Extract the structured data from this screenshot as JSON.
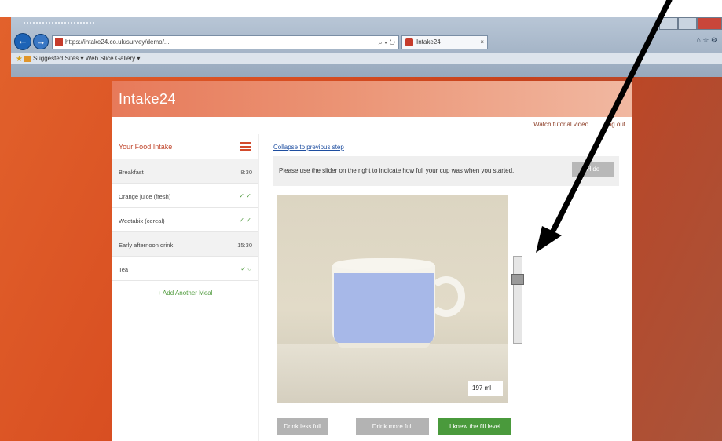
{
  "browser": {
    "address_url": "https://intake24.co.uk/survey/demo/...",
    "search_tools": "⌕ ▾ ↻",
    "tab_title": "Intake24",
    "tab_close": "×",
    "right_tools": "⌂ ☆ ⚙",
    "favorites_bar": "Suggested Sites ▾   Web Slice Gallery ▾"
  },
  "header": {
    "brand": "Intake24",
    "links": [
      "Watch tutorial video",
      "Log out"
    ]
  },
  "sidebar": {
    "title": "Your Food Intake",
    "meals": [
      {
        "name": "Breakfast",
        "time": "8:30",
        "status": ""
      },
      {
        "name": "Orange juice (fresh)",
        "time": "",
        "status": "✓ ✓"
      },
      {
        "name": "Weetabix (cereal)",
        "time": "",
        "status": "✓ ✓"
      },
      {
        "name": "Early afternoon drink",
        "time": "15:30",
        "status": ""
      },
      {
        "name": "Tea",
        "time": "",
        "status": "✓ ○"
      }
    ],
    "add_meal": "+ Add Another Meal"
  },
  "main": {
    "collapse_link": "Collapse to previous step",
    "instruction": "Please use the slider on the right to indicate how full your cup was when you started.",
    "hide_button": "Hide",
    "volume_value": "197 ml",
    "fill_level": 0.78,
    "buttons": {
      "less": "Drink less full",
      "more": "Drink more full",
      "done": "I knew the fill level"
    }
  },
  "colors": {
    "brand_header": "#e77a5a",
    "accent_red": "#c0452b",
    "ok_green": "#4a9a3c",
    "cup_fill_blue": "#a7b8e8"
  }
}
